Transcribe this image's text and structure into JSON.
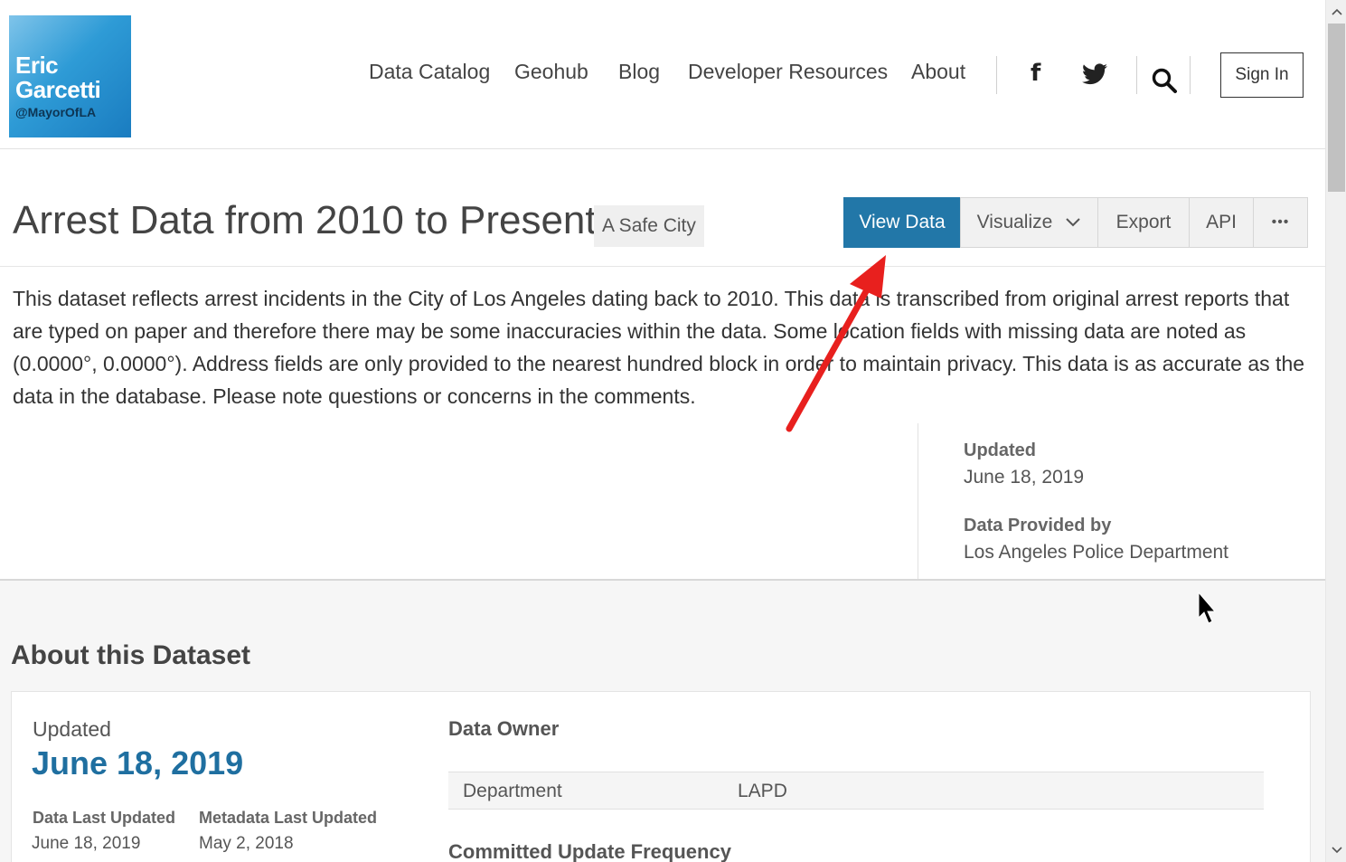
{
  "header": {
    "logo": {
      "line1": "Eric",
      "line2": "Garcetti",
      "handle": "@MayorOfLA"
    },
    "nav": [
      "Data Catalog",
      "Geohub",
      "Blog",
      "Developer Resources",
      "About"
    ],
    "social": {
      "facebook": "f"
    },
    "sign_in": "Sign In"
  },
  "dataset": {
    "title": "Arrest Data from 2010 to Present",
    "category": "A Safe City",
    "actions": {
      "view_data": "View Data",
      "visualize": "Visualize",
      "export": "Export",
      "api": "API",
      "more": "•••"
    },
    "description": "This dataset reflects arrest incidents in the City of Los Angeles dating back to 2010. This data is transcribed from original arrest reports that are typed on paper and therefore there may be some inaccuracies within the data. Some location fields with missing data are noted as (0.0000°, 0.0000°). Address fields are only provided to the nearest hundred block in order to maintain privacy. This data is as accurate as the data in the database. Please note questions or concerns in the comments.",
    "meta": {
      "updated_label": "Updated",
      "updated_value": "June 18, 2019",
      "provided_label": "Data Provided by",
      "provided_value": "Los Angeles Police Department"
    }
  },
  "about": {
    "title": "About this Dataset",
    "updated_label": "Updated",
    "updated_date": "June 18, 2019",
    "data_last_updated_label": "Data Last Updated",
    "data_last_updated_value": "June 18, 2019",
    "metadata_last_updated_label": "Metadata Last Updated",
    "metadata_last_updated_value": "May 2, 2018",
    "owner_heading": "Data Owner",
    "owner_row": {
      "key": "Department",
      "value": "LAPD"
    },
    "frequency_heading": "Committed Update Frequency"
  },
  "colors": {
    "primary": "#2277a8",
    "date_accent": "#1f6fa0",
    "arrow": "#e8201e"
  },
  "icons": {
    "dropdown": "chevron-down-icon",
    "search": "search-icon",
    "twitter": "twitter-icon",
    "facebook": "facebook-icon"
  }
}
